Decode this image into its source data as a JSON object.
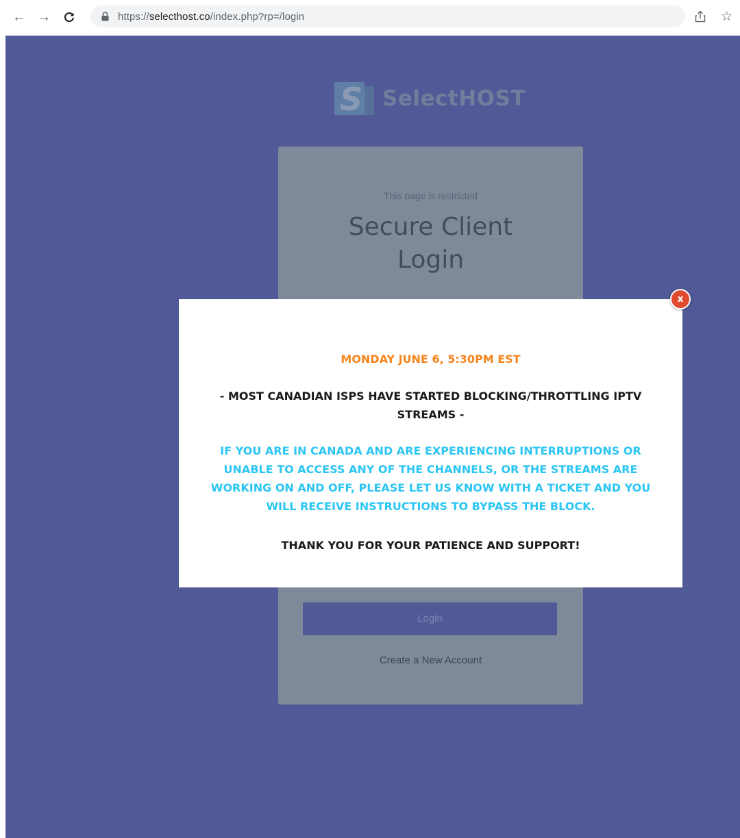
{
  "browser": {
    "url_scheme": "https://",
    "url_host": "selecthost.co",
    "url_path": "/index.php?rp=/login",
    "icons": [
      "back-arrow-icon",
      "forward-arrow-icon",
      "reload-icon",
      "lock-icon",
      "share-icon",
      "star-icon"
    ]
  },
  "logo": {
    "text": "SelectHOST",
    "mark_letter": "S"
  },
  "login_card": {
    "restricted_text": "This page is restricted",
    "title_line1": "Secure Client",
    "title_line2": "Login",
    "login_button": "Login",
    "create_account_link": "Create a New Account"
  },
  "modal": {
    "close_label": "x",
    "date_line": "MONDAY JUNE 6, 5:30PM EST",
    "block_line1": "- MOST CANADIAN ISPS HAVE STARTED BLOCKING/THROTTLING IPTV",
    "block_line2": "STREAMS -",
    "info_line1": "IF YOU ARE IN CANADA AND ARE EXPERIENCING INTERRUPTIONS OR",
    "info_line2": "UNABLE TO ACCESS ANY OF THE CHANNELS, OR THE STREAMS ARE",
    "info_line3": "WORKING ON AND OFF, PLEASE LET US KNOW WITH A TICKET AND YOU",
    "info_line4": "WILL RECEIVE INSTRUCTIONS TO BYPASS THE BLOCK.",
    "thanks_line": "THANK YOU FOR YOUR PATIENCE AND SUPPORT!"
  },
  "colors": {
    "page_background": "#515a97",
    "date_accent": "#f7851c",
    "info_accent": "#2bc6f3",
    "close_button": "#e04a2f"
  }
}
